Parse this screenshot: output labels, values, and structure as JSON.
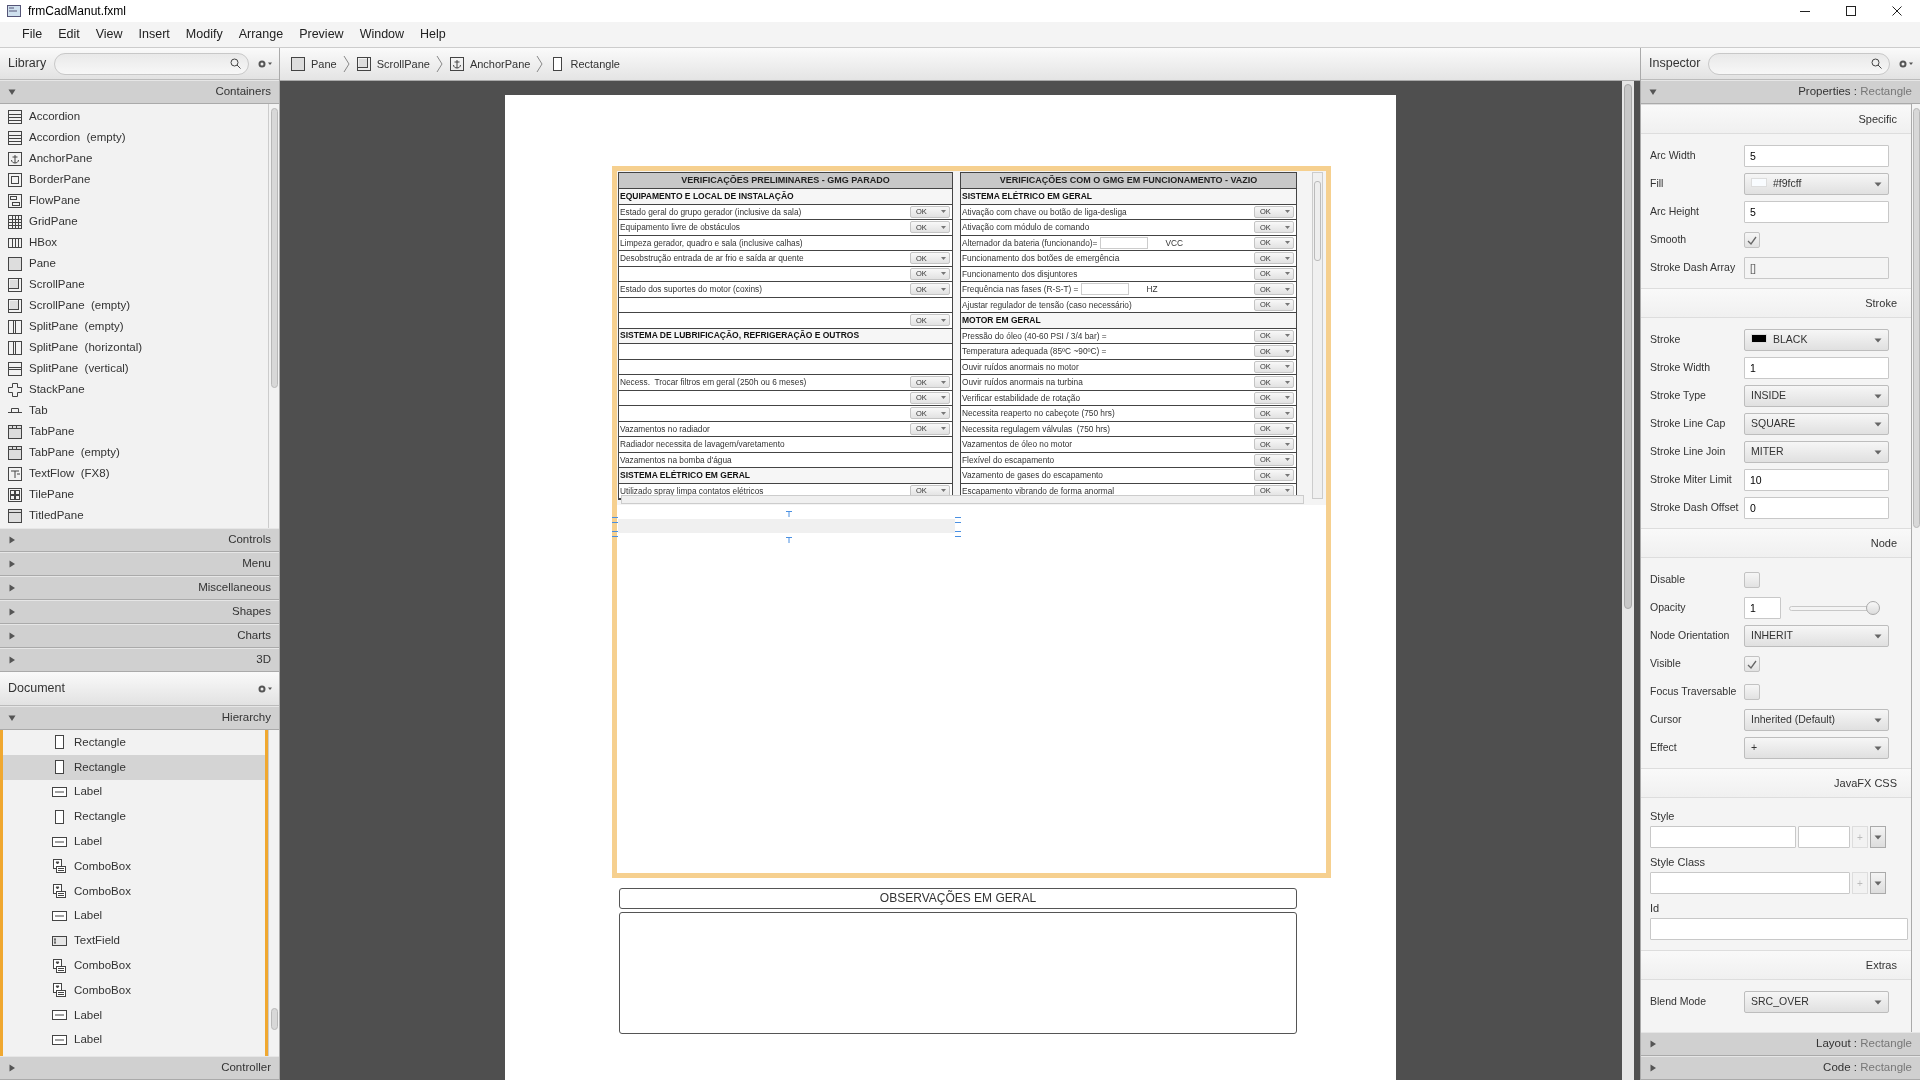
{
  "window": {
    "title": "frmCadManut.fxml"
  },
  "menu": [
    "File",
    "Edit",
    "View",
    "Insert",
    "Modify",
    "Arrange",
    "Preview",
    "Window",
    "Help"
  ],
  "library": {
    "title": "Library",
    "sections": [
      {
        "label": "Containers",
        "expanded": true,
        "items": [
          {
            "label": "Accordion",
            "kind": "accordion"
          },
          {
            "label": "Accordion  (empty)",
            "kind": "accordion"
          },
          {
            "label": "AnchorPane",
            "kind": "anchor"
          },
          {
            "label": "BorderPane",
            "kind": "border"
          },
          {
            "label": "FlowPane",
            "kind": "flow"
          },
          {
            "label": "GridPane",
            "kind": "grid"
          },
          {
            "label": "HBox",
            "kind": "hbox"
          },
          {
            "label": "Pane",
            "kind": "pane"
          },
          {
            "label": "ScrollPane",
            "kind": "scroll"
          },
          {
            "label": "ScrollPane  (empty)",
            "kind": "scroll"
          },
          {
            "label": "SplitPane  (empty)",
            "kind": "splith"
          },
          {
            "label": "SplitPane  (horizontal)",
            "kind": "splith"
          },
          {
            "label": "SplitPane  (vertical)",
            "kind": "splitv"
          },
          {
            "label": "StackPane",
            "kind": "stack"
          },
          {
            "label": "Tab",
            "kind": "tab"
          },
          {
            "label": "TabPane",
            "kind": "tabpane"
          },
          {
            "label": "TabPane  (empty)",
            "kind": "tabpane"
          },
          {
            "label": "TextFlow  (FX8)",
            "kind": "textflow"
          },
          {
            "label": "TilePane",
            "kind": "tile"
          },
          {
            "label": "TitledPane",
            "kind": "titled"
          }
        ]
      },
      {
        "label": "Controls",
        "expanded": false
      },
      {
        "label": "Menu",
        "expanded": false
      },
      {
        "label": "Miscellaneous",
        "expanded": false
      },
      {
        "label": "Shapes",
        "expanded": false
      },
      {
        "label": "Charts",
        "expanded": false
      },
      {
        "label": "3D",
        "expanded": false
      }
    ]
  },
  "document": {
    "title": "Document",
    "sections": [
      {
        "label": "Hierarchy",
        "expanded": true,
        "items": [
          {
            "label": "Rectangle",
            "kind": "rectangle",
            "selected": false
          },
          {
            "label": "Rectangle",
            "kind": "rectangle",
            "selected": true
          },
          {
            "label": "Label",
            "kind": "label",
            "selected": false
          },
          {
            "label": "Rectangle",
            "kind": "rectangle",
            "selected": false
          },
          {
            "label": "Label",
            "kind": "label",
            "selected": false
          },
          {
            "label": "ComboBox",
            "kind": "combo",
            "selected": false
          },
          {
            "label": "ComboBox",
            "kind": "combo",
            "selected": false
          },
          {
            "label": "Label",
            "kind": "label",
            "selected": false
          },
          {
            "label": "TextField",
            "kind": "textfield",
            "selected": false
          },
          {
            "label": "ComboBox",
            "kind": "combo",
            "selected": false
          },
          {
            "label": "ComboBox",
            "kind": "combo",
            "selected": false
          },
          {
            "label": "Label",
            "kind": "label",
            "selected": false
          },
          {
            "label": "Label",
            "kind": "label",
            "selected": false
          }
        ]
      },
      {
        "label": "Controller",
        "expanded": false
      }
    ]
  },
  "breadcrumb": [
    {
      "label": "Pane",
      "kind": "pane"
    },
    {
      "label": "ScrollPane",
      "kind": "scroll"
    },
    {
      "label": "AnchorPane",
      "kind": "anchor"
    },
    {
      "label": "Rectangle",
      "kind": "rectangle"
    }
  ],
  "form": {
    "columns": [
      {
        "title": "VERIFICAÇÕES PRELIMINARES - GMG PARADO",
        "rows": [
          {
            "kind": "section",
            "text": "EQUIPAMENTO E LOCAL DE INSTALAÇÃO"
          },
          {
            "kind": "item",
            "text": "Estado geral do grupo gerador (inclusive da sala)",
            "status": "OK"
          },
          {
            "kind": "item",
            "text": "Equipamento livre de obstáculos",
            "status": "OK"
          },
          {
            "kind": "item",
            "text": "Limpeza gerador, quadro e sala (inclusive calhas)"
          },
          {
            "kind": "item",
            "text": "Desobstrução entrada de ar frio e saída ar quente",
            "status": "OK"
          },
          {
            "kind": "item",
            "status": "OK"
          },
          {
            "kind": "item",
            "text": "Estado dos suportes do motor (coxins)",
            "status": "OK"
          },
          {
            "kind": "item"
          },
          {
            "kind": "item",
            "status": "OK"
          },
          {
            "kind": "section",
            "text": "SISTEMA DE LUBRIFICAÇÃO, REFRIGERAÇÃO E OUTROS"
          },
          {
            "kind": "item"
          },
          {
            "kind": "item"
          },
          {
            "kind": "item",
            "text": "Necess.  Trocar filtros em geral (250h ou 6 meses)",
            "status": "OK"
          },
          {
            "kind": "item",
            "status": "OK"
          },
          {
            "kind": "item",
            "status": "OK"
          },
          {
            "kind": "item",
            "text": "Vazamentos no radiador",
            "status": "OK"
          },
          {
            "kind": "item",
            "text": "Radiador necessita de lavagem/varetamento"
          },
          {
            "kind": "item",
            "text": "Vazamentos na bomba d'água"
          },
          {
            "kind": "section",
            "text": "SISTEMA ELÉTRICO EM GERAL"
          },
          {
            "kind": "item",
            "text": "Utilizado spray limpa contatos elétricos",
            "status": "OK"
          }
        ]
      },
      {
        "title": "VERIFICAÇÕES COM O GMG EM FUNCIONAMENTO - VAZIO",
        "rows": [
          {
            "kind": "section",
            "text": "SISTEMA ELÉTRICO EM GERAL"
          },
          {
            "kind": "item",
            "text": "Ativação com chave ou botão de liga-desliga",
            "status": "OK"
          },
          {
            "kind": "item",
            "text": "Ativação com módulo de comando",
            "status": "OK"
          },
          {
            "kind": "item",
            "text": "Alternador da bateria (funcionando)=",
            "unit": "VCC",
            "status": "OK"
          },
          {
            "kind": "item",
            "text": "Funcionamento dos botões de emergência",
            "status": "OK"
          },
          {
            "kind": "item",
            "text": "Funcionamento dos disjuntores",
            "status": "OK"
          },
          {
            "kind": "item",
            "text": "Frequência nas fases (R-S-T) =",
            "unit": "HZ",
            "status": "OK"
          },
          {
            "kind": "item",
            "text": "Ajustar regulador de tensão (caso necessário)",
            "status": "OK"
          },
          {
            "kind": "section",
            "text": "MOTOR EM GERAL"
          },
          {
            "kind": "item",
            "text": "Pressão do óleo (40-60 PSI / 3/4 bar) =",
            "status": "OK"
          },
          {
            "kind": "item",
            "text": "Temperatura adequada (85ºC ~90ºC) =",
            "status": "OK"
          },
          {
            "kind": "item",
            "text": "Ouvir ruídos anormais no motor",
            "status": "OK"
          },
          {
            "kind": "item",
            "text": "Ouvir ruídos anormais na turbina",
            "status": "OK"
          },
          {
            "kind": "item",
            "text": "Verificar estabilidade de rotação",
            "status": "OK"
          },
          {
            "kind": "item",
            "text": "Necessita reaperto no cabeçote (750 hrs)",
            "status": "OK"
          },
          {
            "kind": "item",
            "text": "Necessita regulagem válvulas  (750 hrs)",
            "status": "OK"
          },
          {
            "kind": "item",
            "text": "Vazamentos de óleo no motor",
            "status": "OK"
          },
          {
            "kind": "item",
            "text": "Flexível do escapamento",
            "status": "OK"
          },
          {
            "kind": "item",
            "text": "Vazamento de gases do escapamento",
            "status": "OK"
          },
          {
            "kind": "item",
            "text": "Escapamento vibrando de forma anormal",
            "status": "OK"
          }
        ]
      }
    ],
    "observations": {
      "title": "OBSERVAÇÕES EM GERAL"
    }
  },
  "inspector": {
    "title": "Inspector",
    "sections": [
      {
        "label": "Properties",
        "separator": ":",
        "target": "Rectangle",
        "expanded": true,
        "groups": [
          {
            "title": "Specific",
            "rows": [
              {
                "kind": "text",
                "label": "Arc Width",
                "value": "5"
              },
              {
                "kind": "color",
                "label": "Fill",
                "value": "#f9fcff",
                "color": "#f9fcff"
              },
              {
                "kind": "text",
                "label": "Arc Height",
                "value": "5"
              },
              {
                "kind": "check",
                "label": "Smooth",
                "checked": true
              },
              {
                "kind": "readonly",
                "label": "Stroke Dash Array",
                "value": "[]"
              }
            ]
          },
          {
            "title": "Stroke",
            "rows": [
              {
                "kind": "color",
                "label": "Stroke",
                "value": "BLACK",
                "color": "#000000"
              },
              {
                "kind": "text",
                "label": "Stroke Width",
                "value": "1"
              },
              {
                "kind": "combo",
                "label": "Stroke Type",
                "value": "INSIDE"
              },
              {
                "kind": "combo",
                "label": "Stroke Line Cap",
                "value": "SQUARE"
              },
              {
                "kind": "combo",
                "label": "Stroke Line Join",
                "value": "MITER"
              },
              {
                "kind": "text",
                "label": "Stroke Miter Limit",
                "value": "10"
              },
              {
                "kind": "text",
                "label": "Stroke Dash Offset",
                "value": "0"
              }
            ]
          },
          {
            "title": "Node",
            "rows": [
              {
                "kind": "check",
                "label": "Disable",
                "checked": false
              },
              {
                "kind": "slider",
                "label": "Opacity",
                "value": "1",
                "level": 1
              },
              {
                "kind": "combo",
                "label": "Node Orientation",
                "value": "INHERIT"
              },
              {
                "kind": "check",
                "label": "Visible",
                "checked": true
              },
              {
                "kind": "check",
                "label": "Focus Traversable",
                "checked": false
              },
              {
                "kind": "combo",
                "label": "Cursor",
                "value": "Inherited (Default)"
              },
              {
                "kind": "combo",
                "label": "Effect",
                "value": "+"
              }
            ]
          },
          {
            "title": "JavaFX CSS",
            "rows": [
              {
                "kind": "style",
                "label": "Style",
                "add_button": "+"
              },
              {
                "kind": "class",
                "label": "Style Class",
                "add_button": "+"
              },
              {
                "kind": "id",
                "label": "Id"
              }
            ]
          },
          {
            "title": "Extras",
            "rows": [
              {
                "kind": "combo",
                "label": "Blend Mode",
                "value": "SRC_OVER"
              }
            ]
          }
        ]
      },
      {
        "label": "Layout",
        "separator": ":",
        "target": "Rectangle",
        "expanded": false
      },
      {
        "label": "Code",
        "separator": ":",
        "target": "Rectangle",
        "expanded": false
      }
    ]
  }
}
